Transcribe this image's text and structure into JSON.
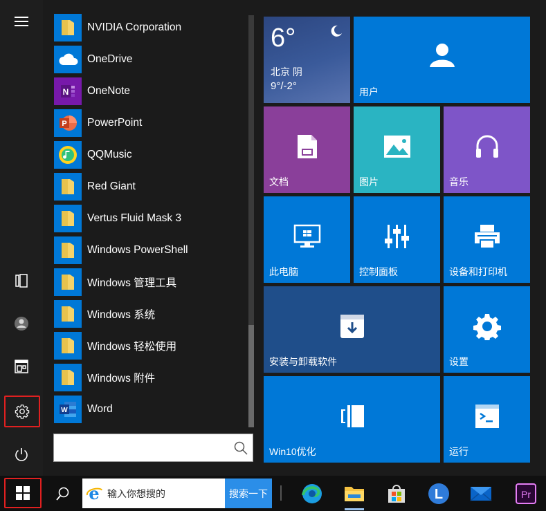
{
  "rail": {
    "items": [
      "menu-icon",
      "documents-icon",
      "user-icon",
      "gallery-icon",
      "gear-icon",
      "power-icon"
    ]
  },
  "apps": [
    {
      "label": "NVIDIA Corporation",
      "icon": "folder-icon"
    },
    {
      "label": "OneDrive",
      "icon": "onedrive-icon"
    },
    {
      "label": "OneNote",
      "icon": "onenote-icon"
    },
    {
      "label": "PowerPoint",
      "icon": "powerpoint-icon"
    },
    {
      "label": "QQMusic",
      "icon": "qqmusic-icon"
    },
    {
      "label": "Red Giant",
      "icon": "folder-icon"
    },
    {
      "label": "Vertus Fluid Mask 3",
      "icon": "folder-icon"
    },
    {
      "label": "Windows PowerShell",
      "icon": "folder-icon"
    },
    {
      "label": "Windows 管理工具",
      "icon": "folder-icon"
    },
    {
      "label": "Windows 系统",
      "icon": "folder-icon"
    },
    {
      "label": "Windows 轻松使用",
      "icon": "folder-icon"
    },
    {
      "label": "Windows 附件",
      "icon": "folder-icon"
    },
    {
      "label": "Word",
      "icon": "word-icon"
    }
  ],
  "tiles": {
    "weather": {
      "temp": "6°",
      "city": "北京  阴",
      "range": "9°/-2°"
    },
    "user": "用户",
    "documents": "文档",
    "pictures": "图片",
    "music": "音乐",
    "this_pc": "此电脑",
    "control_panel": "控制面板",
    "devices_printers": "设备和打印机",
    "install_uninstall": "安装与卸载软件",
    "settings": "设置",
    "win10_optimize": "Win10优化",
    "run": "运行"
  },
  "taskbar": {
    "search_placeholder": "输入你想搜的",
    "search_button": "搜索一下",
    "pinned": [
      "edge-icon",
      "file-explorer-icon",
      "store-icon",
      "l-app-icon",
      "mail-icon",
      "premiere-icon"
    ]
  },
  "colors": {
    "tile_blue": "#0078d7",
    "tile_purple": "#8a3f9a",
    "tile_teal": "#2ab4c2",
    "tile_violet": "#7e55c8",
    "tile_dark_blue": "#1f4e8a",
    "highlight_red": "#e02020"
  }
}
